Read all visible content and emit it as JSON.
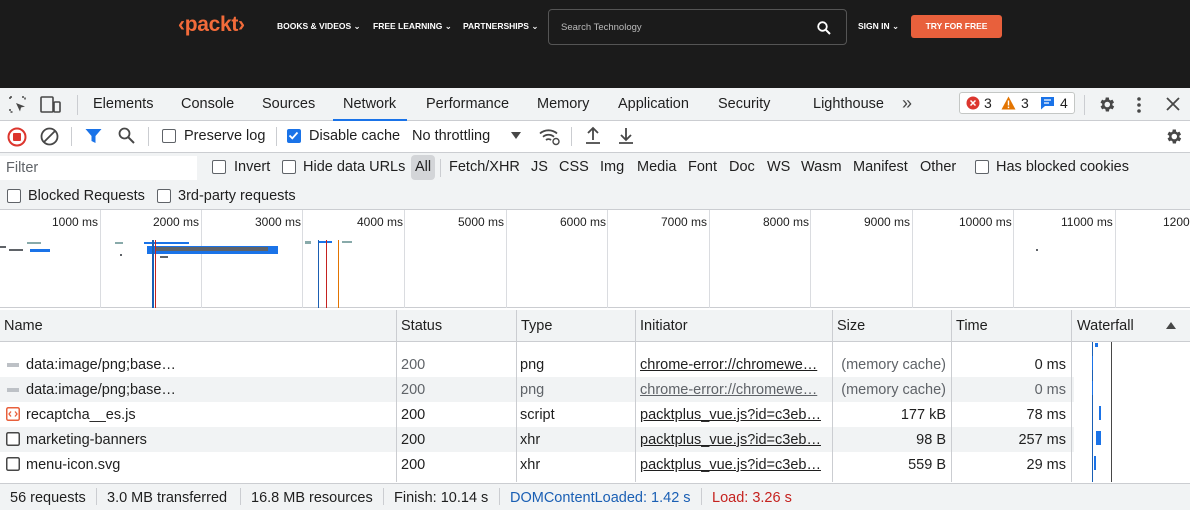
{
  "site": {
    "logo": "‹packt›",
    "nav": [
      "BOOKS & VIDEOS",
      "FREE LEARNING",
      "PARTNERSHIPS"
    ],
    "search_placeholder": "Search Technology",
    "sign_in": "SIGN IN",
    "cta": "TRY FOR FREE"
  },
  "devtools": {
    "tabs": [
      "Elements",
      "Console",
      "Sources",
      "Network",
      "Performance",
      "Memory",
      "Application",
      "Security",
      "Lighthouse"
    ],
    "more": "»",
    "issues": {
      "errors": "3",
      "warnings": "3",
      "messages": "4"
    },
    "toolbar": {
      "preserve_log": "Preserve log",
      "preserve_log_checked": false,
      "disable_cache": "Disable cache",
      "disable_cache_checked": true,
      "throttling": "No throttling"
    },
    "filter": {
      "placeholder": "Filter",
      "invert": "Invert",
      "hide_data_urls": "Hide data URLs",
      "types": [
        "All",
        "Fetch/XHR",
        "JS",
        "CSS",
        "Img",
        "Media",
        "Font",
        "Doc",
        "WS",
        "Wasm",
        "Manifest",
        "Other"
      ],
      "selected_type": "All",
      "has_blocked_cookies": "Has blocked cookies",
      "blocked_requests": "Blocked Requests",
      "third_party": "3rd-party requests"
    },
    "overview_ticks": [
      "1000 ms",
      "2000 ms",
      "3000 ms",
      "4000 ms",
      "5000 ms",
      "6000 ms",
      "7000 ms",
      "8000 ms",
      "9000 ms",
      "10000 ms",
      "11000 ms",
      "1200"
    ],
    "table": {
      "headers": [
        "Name",
        "Status",
        "Type",
        "Initiator",
        "Size",
        "Time",
        "Waterfall"
      ],
      "rows": [
        {
          "icon": "image-icon",
          "name": "data:image/png;base…",
          "status": "200",
          "type": "png",
          "initiator": "chrome-error://chromewe…",
          "size": "(memory cache)",
          "time": "0 ms"
        },
        {
          "icon": "image-icon",
          "name": "data:image/png;base…",
          "status": "200",
          "type": "png",
          "initiator": "chrome-error://chromewe…",
          "size": "(memory cache)",
          "time": "0 ms"
        },
        {
          "icon": "script-icon",
          "name": "recaptcha__es.js",
          "status": "200",
          "type": "script",
          "initiator": "packtplus_vue.js?id=c3eb…",
          "size": "177 kB",
          "time": "78 ms"
        },
        {
          "icon": "document-icon",
          "name": "marketing-banners",
          "status": "200",
          "type": "xhr",
          "initiator": "packtplus_vue.js?id=c3eb…",
          "size": "98 B",
          "time": "257 ms"
        },
        {
          "icon": "document-icon",
          "name": "menu-icon.svg",
          "status": "200",
          "type": "xhr",
          "initiator": "packtplus_vue.js?id=c3eb…",
          "size": "559 B",
          "time": "29 ms"
        }
      ]
    },
    "status": {
      "requests": "56 requests",
      "transferred": "3.0 MB transferred",
      "resources": "16.8 MB resources",
      "finish": "Finish: 10.14 s",
      "dom_content_loaded": "DOMContentLoaded: 1.42 s",
      "load": "Load: 3.26 s"
    },
    "colors": {
      "accent": "#1a73e8",
      "dcl": "#1a5fb4",
      "load": "#c5221f",
      "brand": "#f26b3a",
      "cta": "#e8603c"
    }
  }
}
